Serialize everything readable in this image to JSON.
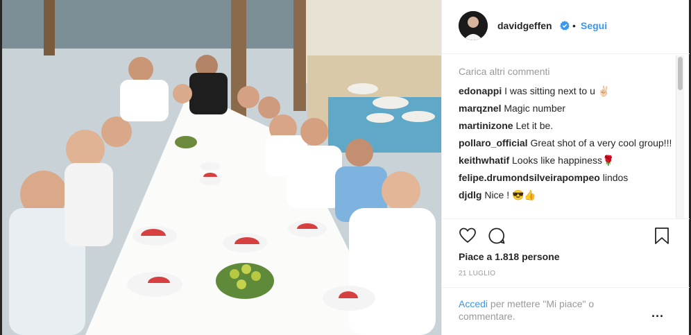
{
  "post": {
    "username": "davidgeffen",
    "follow_label": "Segui",
    "separator": "•",
    "load_more": "Carica altri commenti",
    "comments": [
      {
        "user": "edonappi",
        "text": "I was sitting next to u ✌🏻"
      },
      {
        "user": "marqznel",
        "text": "Magic number"
      },
      {
        "user": "martinizone",
        "text": "Let it be."
      },
      {
        "user": "pollaro_official",
        "text": "Great shot of a very cool group!!!"
      },
      {
        "user": "keithwhatif",
        "text": "Looks like happiness🌹"
      },
      {
        "user": "felipe.drumondsilveirapompeo",
        "text": "lindos"
      },
      {
        "user": "djdlg",
        "text": "Nice ! 😎👍"
      }
    ],
    "likes": "Piace a 1.818 persone",
    "date": "21 LUGLIO",
    "login_link": "Accedi",
    "login_rest": " per mettere \"Mi piace\" o commentare.",
    "more_label": "..."
  },
  "colors": {
    "link": "#3897f0",
    "text": "#262626",
    "muted": "#999999"
  },
  "icons": [
    "verified-badge-icon",
    "heart-icon",
    "comment-icon",
    "bookmark-icon",
    "more-options-icon"
  ]
}
